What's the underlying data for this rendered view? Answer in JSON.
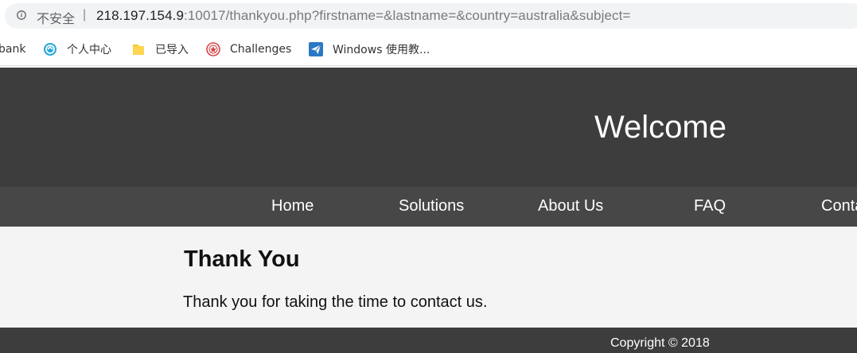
{
  "browser": {
    "security_label": "不安全",
    "divider": "|",
    "url_host": "218.197.154.9",
    "url_rest": ":10017/thankyou.php?firstname=&lastname=&country=australia&subject=",
    "bookmarks": [
      {
        "label": "bank",
        "icon": "none"
      },
      {
        "label": "个人中心",
        "icon": "circle-logo-icon"
      },
      {
        "label": "已导入",
        "icon": "folder-icon"
      },
      {
        "label": "Challenges",
        "icon": "challenge-logo-icon"
      },
      {
        "label": "Windows 使用教...",
        "icon": "send-icon"
      }
    ]
  },
  "site": {
    "title": "Welcome",
    "nav": [
      "Home",
      "Solutions",
      "About Us",
      "FAQ",
      "Conta"
    ],
    "heading": "Thank You",
    "message": "Thank you for taking the time to contact us.",
    "copyright": "Copyright © 2018"
  },
  "colors": {
    "header_bg": "#3d3d3d",
    "nav_bg": "#474747",
    "content_bg": "#f4f4f4",
    "footer_bg": "#3d3d3d",
    "address_pill_bg": "#f1f3f4"
  }
}
